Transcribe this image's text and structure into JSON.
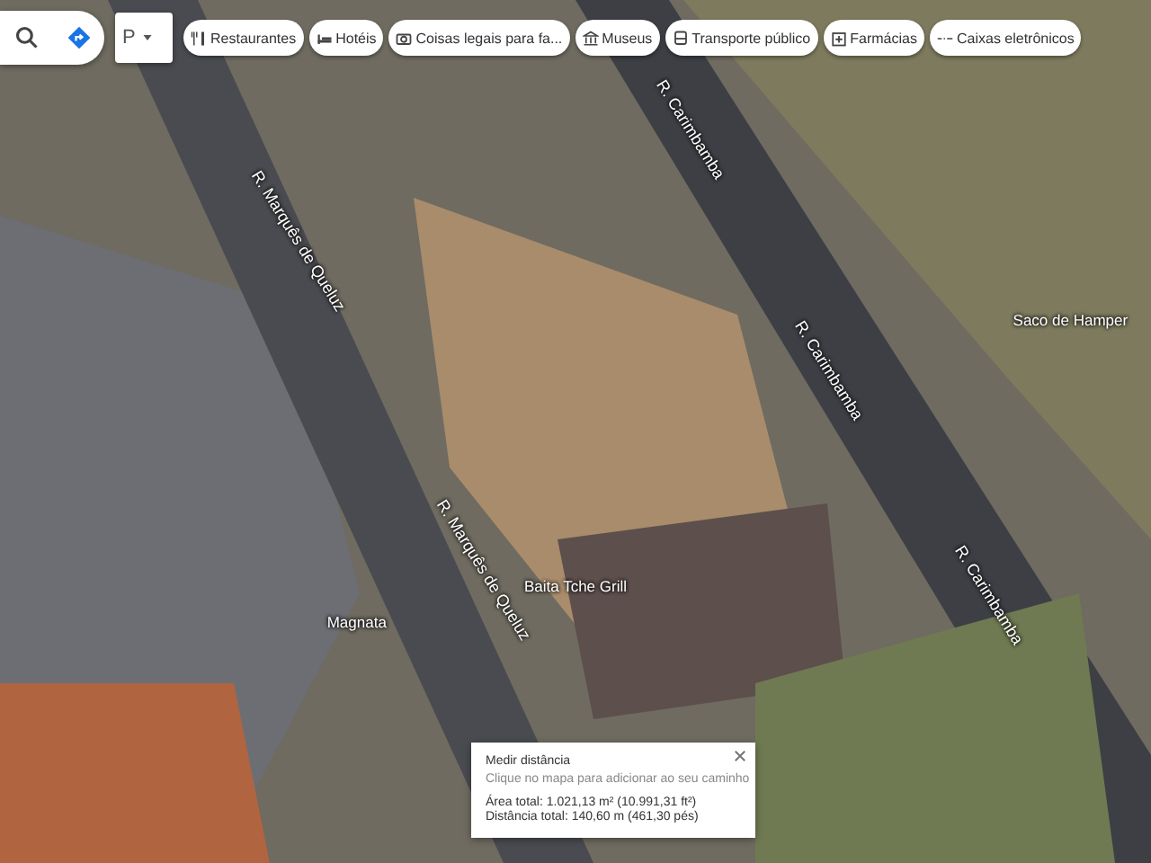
{
  "search": {
    "kind": "search"
  },
  "layers_button": {
    "label": "P"
  },
  "categories": [
    {
      "label": "Restaurantes"
    },
    {
      "label": "Hotéis"
    },
    {
      "label": "Coisas legais para fa..."
    },
    {
      "label": "Museus"
    },
    {
      "label": "Transporte público"
    },
    {
      "label": "Farmácias"
    },
    {
      "label": "Caixas eletrônicos"
    }
  ],
  "map_labels": [
    {
      "text": "R. Marquês de Queluz",
      "kind": "street"
    },
    {
      "text": "R. Marquês de Queluz",
      "kind": "street"
    },
    {
      "text": "R. Carimbamba",
      "kind": "street"
    },
    {
      "text": "R. Carimbamba",
      "kind": "street"
    },
    {
      "text": "R. Carimbamba",
      "kind": "street"
    },
    {
      "text": "Baita Tche Grill",
      "kind": "place"
    },
    {
      "text": "Saco de Hamper",
      "kind": "place"
    },
    {
      "text": "Magnata",
      "kind": "place"
    }
  ],
  "measure_panel": {
    "title": "Medir distância",
    "hint": "Clique no mapa para adicionar ao seu caminho",
    "area": "Área total: 1.021,13 m² (10.991,31 ft²)",
    "distance": "Distância total: 140,60 m (461,30 pés)"
  }
}
